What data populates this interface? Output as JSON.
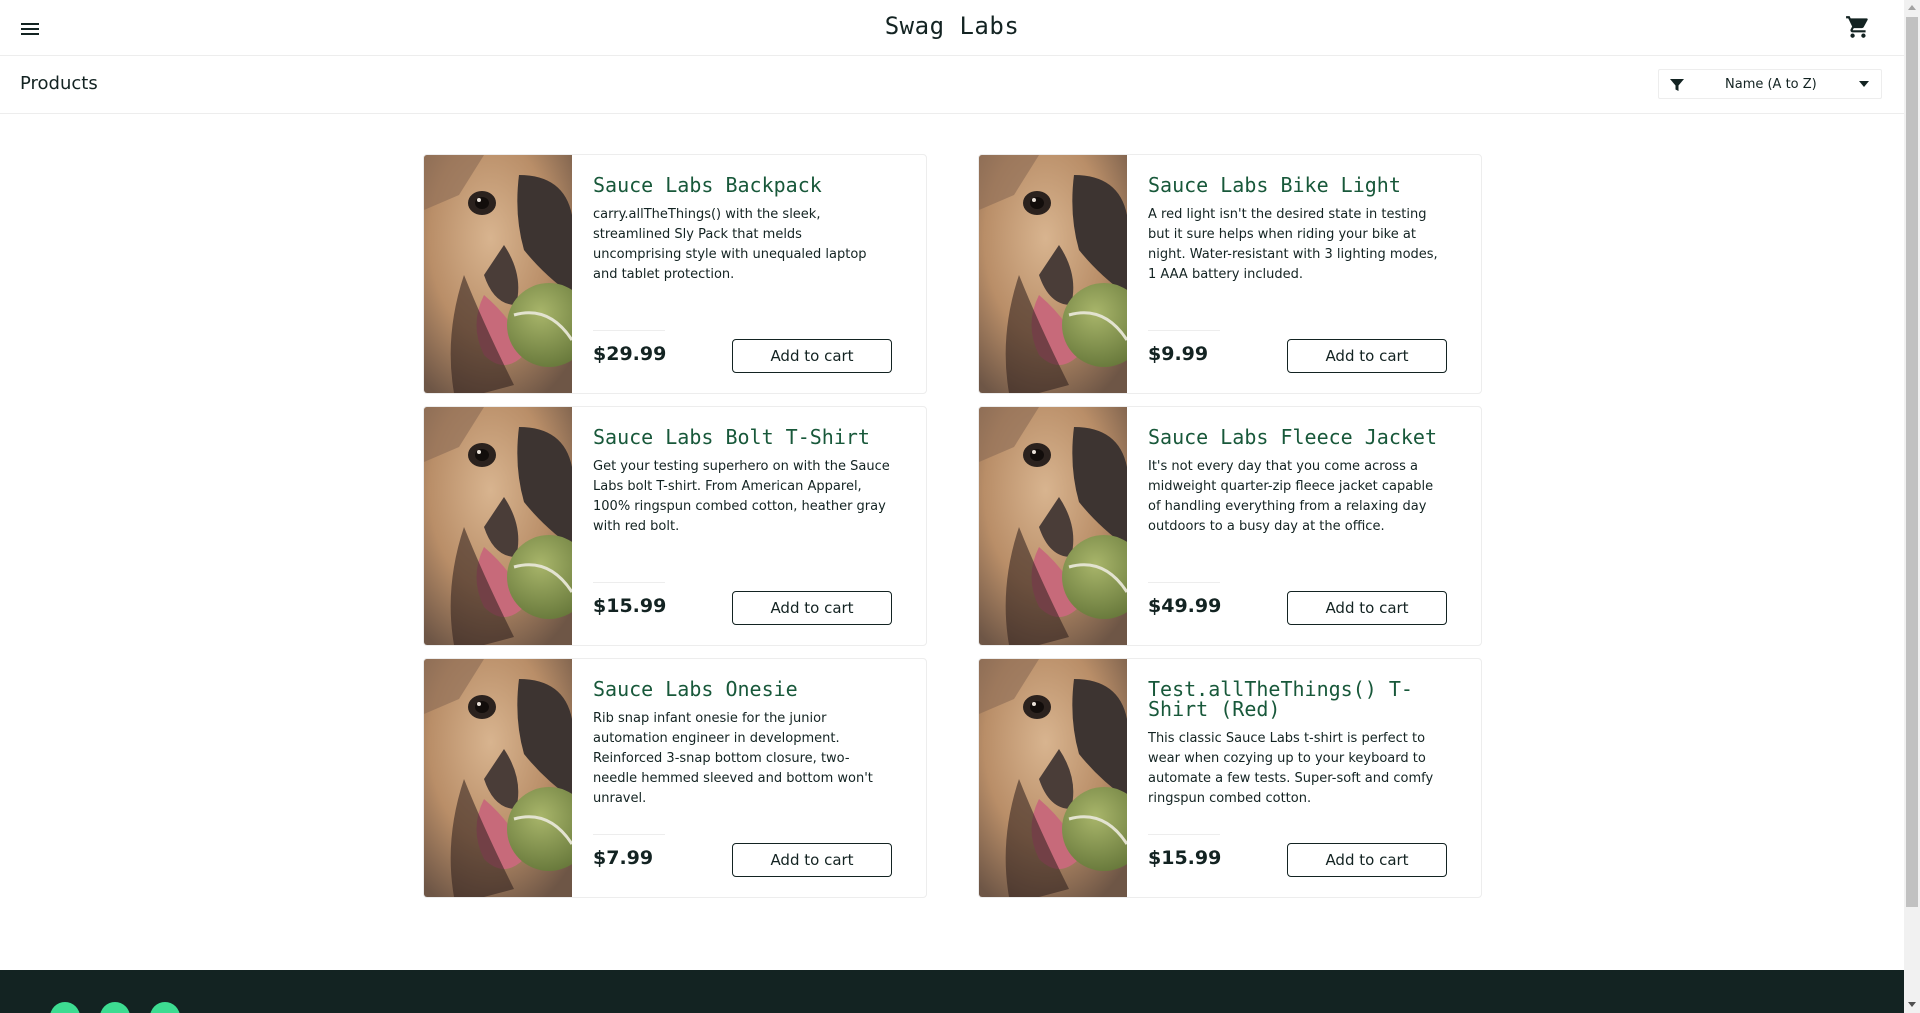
{
  "header": {
    "title": "Swag Labs",
    "menu_icon": "hamburger-menu-icon",
    "cart_icon": "shopping-cart-icon"
  },
  "subheader": {
    "title": "Products",
    "sort": {
      "icon": "filter-icon",
      "selected": "Name (A to Z)"
    }
  },
  "colors": {
    "product_name": "#18583a",
    "text": "#132322",
    "border": "#ededed",
    "footer": "#132322",
    "social_accent": "#3ddc91"
  },
  "products": [
    {
      "name": "Sauce Labs Backpack",
      "description": "carry.allTheThings() with the sleek, streamlined Sly Pack that melds uncomprising style with unequaled laptop and tablet protection.",
      "price": "$29.99",
      "button": "Add to cart"
    },
    {
      "name": "Sauce Labs Bike Light",
      "description": "A red light isn't the desired state in testing but it sure helps when riding your bike at night. Water-resistant with 3 lighting modes, 1 AAA battery included.",
      "price": "$9.99",
      "button": "Add to cart"
    },
    {
      "name": "Sauce Labs Bolt T-Shirt",
      "description": "Get your testing superhero on with the Sauce Labs bolt T-shirt. From American Apparel, 100% ringspun combed cotton, heather gray with red bolt.",
      "price": "$15.99",
      "button": "Add to cart"
    },
    {
      "name": "Sauce Labs Fleece Jacket",
      "description": "It's not every day that you come across a midweight quarter-zip fleece jacket capable of handling everything from a relaxing day outdoors to a busy day at the office.",
      "price": "$49.99",
      "button": "Add to cart"
    },
    {
      "name": "Sauce Labs Onesie",
      "description": "Rib snap infant onesie for the junior automation engineer in development. Reinforced 3-snap bottom closure, two-needle hemmed sleeved and bottom won't unravel.",
      "price": "$7.99",
      "button": "Add to cart"
    },
    {
      "name": "Test.allTheThings() T-Shirt (Red)",
      "description": "This classic Sauce Labs t-shirt is perfect to wear when cozying up to your keyboard to automate a few tests. Super-soft and comfy ringspun combed cotton.",
      "price": "$15.99",
      "button": "Add to cart"
    }
  ],
  "footer": {
    "social_icons": [
      "twitter-icon",
      "facebook-icon",
      "linkedin-icon"
    ]
  }
}
